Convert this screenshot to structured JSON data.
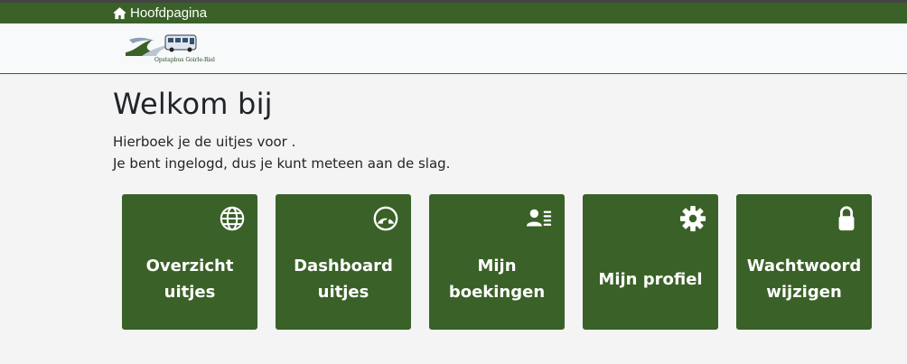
{
  "nav": {
    "home_label": "Hoofdpagina",
    "home_icon": "home-icon"
  },
  "logo": {
    "text": "Opstapbus Goirle-Riel"
  },
  "main": {
    "title": "Welkom bij",
    "line1": "Hierboek je de uitjes voor .",
    "line2": "Je bent ingelogd, dus je kunt meteen aan de slag."
  },
  "tiles": [
    {
      "label": "Overzicht uitjes",
      "icon": "globe-icon"
    },
    {
      "label": "Dashboard uitjes",
      "icon": "speedometer-icon"
    },
    {
      "label": "Mijn boekingen",
      "icon": "contact-card-icon"
    },
    {
      "label": "Mijn profiel",
      "icon": "gear-icon"
    },
    {
      "label": "Wachtwoord wijzigen",
      "icon": "lock-icon"
    }
  ],
  "colors": {
    "brand_green": "#3a6128",
    "background": "#f4f4f4",
    "header_background": "#f8f9fa"
  }
}
